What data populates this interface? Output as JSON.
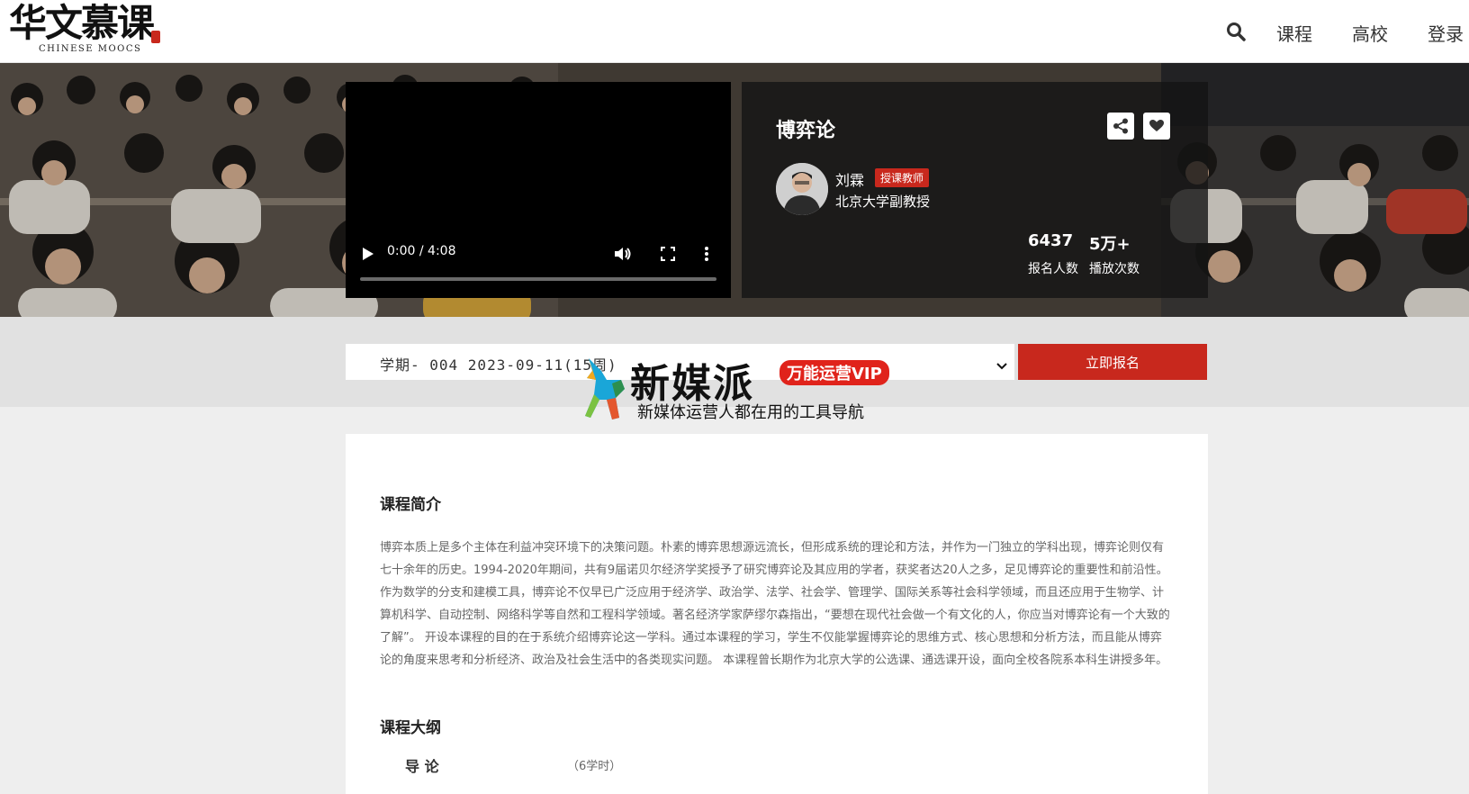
{
  "header": {
    "logo_cn": "华文慕课",
    "logo_en": "CHINESE MOOCS",
    "nav": [
      {
        "label": "课程"
      },
      {
        "label": "高校"
      },
      {
        "label": "登录"
      }
    ]
  },
  "video": {
    "time": "0:00 / 4:08",
    "progress": 0
  },
  "course": {
    "title": "博弈论",
    "teacher": {
      "name": "刘霖",
      "badge": "授课教师",
      "title": "北京大学副教授"
    },
    "stats": [
      {
        "value": "6437",
        "label": "报名人数"
      },
      {
        "value": "5万+",
        "label": "播放次数"
      }
    ]
  },
  "enroll": {
    "term": "学期- 004 2023-09-11(15周)",
    "button": "立即报名"
  },
  "watermark": {
    "name": "新媒派",
    "vip": "万能运营VIP",
    "slogan": "新媒体运营人都在用的工具导航"
  },
  "content": {
    "intro_title": "课程简介",
    "intro_text": "博弈本质上是多个主体在利益冲突环境下的决策问题。朴素的博弈思想源远流长，但形成系统的理论和方法，并作为一门独立的学科出现，博弈论则仅有七十余年的历史。1994-2020年期间，共有9届诺贝尔经济学奖授予了研究博弈论及其应用的学者，获奖者达20人之多，足见博弈论的重要性和前沿性。 作为数学的分支和建模工具，博弈论不仅早已广泛应用于经济学、政治学、法学、社会学、管理学、国际关系等社会科学领域，而且还应用于生物学、计算机科学、自动控制、网络科学等自然和工程科学领域。著名经济学家萨缪尔森指出，“要想在现代社会做一个有文化的人，你应当对博弈论有一个大致的了解”。 开设本课程的目的在于系统介绍博弈论这一学科。通过本课程的学习，学生不仅能掌握博弈论的思维方式、核心思想和分析方法，而且能从博弈论的角度来思考和分析经济、政治及社会生活中的各类现实问题。 本课程曾长期作为北京大学的公选课、通选课开设，面向全校各院系本科生讲授多年。",
    "outline_title": "课程大纲",
    "outline": [
      {
        "name": "导 论",
        "hours": "（6学时）"
      }
    ]
  },
  "colors": {
    "accent": "#c8281d",
    "info_bg": "rgba(20,20,20,0.80)"
  }
}
